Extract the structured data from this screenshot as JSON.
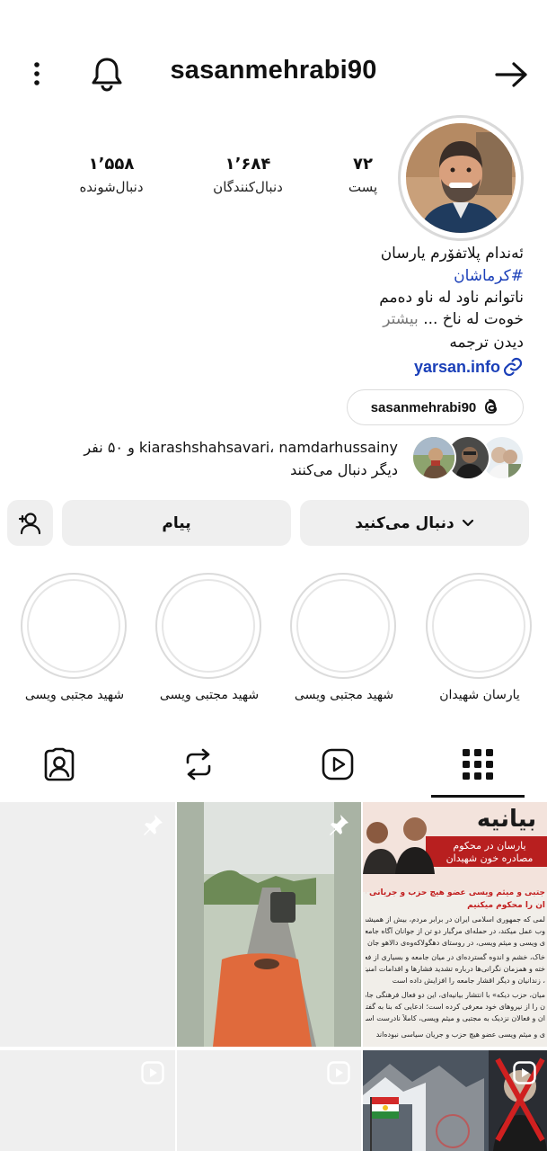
{
  "header": {
    "username": "sasanmehrabi90"
  },
  "stats": [
    {
      "value": "۷۲",
      "label": "پست"
    },
    {
      "value": "۱٬۶۸۴",
      "label": "دنبال‌کنندگان"
    },
    {
      "value": "۱٬۵۵۸",
      "label": "دنبال‌شونده"
    }
  ],
  "bio": {
    "line1": "ئەندام پلاتفۆرم یارسان",
    "hashtag": "#کرماشان",
    "line3": "ناتوانم ناود له ناو دەمم",
    "line4_text": "خوەت له ناخ ...",
    "more": "بیشتر",
    "translate": "دیدن ترجمه",
    "link": "yarsan.info"
  },
  "threads_chip": {
    "handle": "sasanmehrabi90"
  },
  "followed_by": {
    "line1": "kiarashshahsavari، namdarhussainy و ۵۰ نفر",
    "line2": "دیگر دنبال می‌کنند"
  },
  "actions": {
    "following_label": "دنبال می‌کنید",
    "message_label": "پیام"
  },
  "highlights": [
    {
      "label": "یارسان شهیدان"
    },
    {
      "label": "شهید مجتبی ویسی"
    },
    {
      "label": "شهید مجتبی ویسی"
    },
    {
      "label": "شهید مجتبی ویسی"
    }
  ],
  "tabs": [
    "grid-icon",
    "reels-icon",
    "reposts-icon",
    "tagged-icon"
  ],
  "posts": {
    "statement": {
      "title": "بیانیه",
      "subtitle1": "یارسان در محکوم",
      "subtitle2": "مصادره خون شهیدان",
      "red1": "جتبی و میثم ویسی عضو هیچ حزب و جریانی نبودند؛ مصادره خ",
      "red2": "ان را محکوم میکنیم",
      "body": [
        "لمی که جمهوری اسلامی ایران در برابر مردم، بیش از همیشه با خ",
        "وب عمل میکند، در حمله‌ای مرگبار دو تن از جوانان آگاه جامعه یار",
        "ی ویسی و میثم ویسی، در روستای دهگولاکەوەی دالاهو جان باختند",
        "خاک، خشم و اندوه گسترده‌ای در میان جامعه و بسیاری از فعالان",
        "خته و همزمان نگرانی‌ها درباره تشدید فشارها و اقدامات امنیتی علیه",
        "، زندانیان و دیگر اقشار جامعه را افزایش داده است",
        "میان، حزب ‌دیکە» با انتشار بیانیه‌ای، این دو فعال فرهنگی جامعه",
        "ن را از نیروهای خود معرفی کرده است؛ ادعایی که بنا به گفته خانوا",
        "ان و فعالان نزدیک به مجتبی و میثم ویسی، کاملاً نادرست است",
        "ی و میثم ویسی عضو هیچ حزب و جریان سیاسی نبوده‌اند"
      ]
    }
  },
  "colors": {
    "link_blue": "#1a3fb8",
    "button_bg": "#efefef",
    "statement_red": "#c21f1f"
  }
}
